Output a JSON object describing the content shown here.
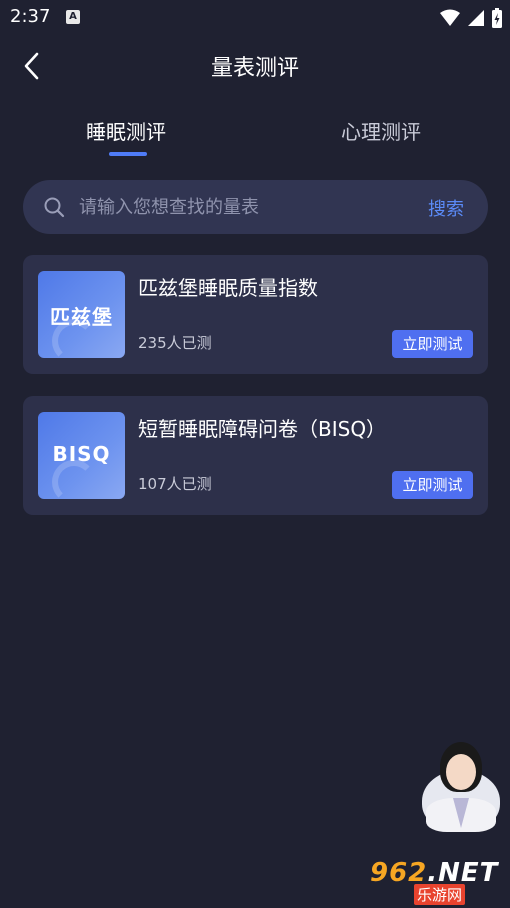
{
  "status_bar": {
    "time": "2:37",
    "notification_icon": "A"
  },
  "header": {
    "title": "量表测评",
    "back_icon": "chevron-left-icon"
  },
  "tabs": [
    {
      "label": "睡眠测评",
      "active": true
    },
    {
      "label": "心理测评",
      "active": false
    }
  ],
  "search": {
    "placeholder": "请输入您想查找的量表",
    "value": "",
    "button_label": "搜索"
  },
  "scales": [
    {
      "thumb_text": "匹兹堡",
      "title": "匹兹堡睡眠质量指数",
      "count": "235人已测",
      "button_label": "立即测试"
    },
    {
      "thumb_text": "BISQ",
      "title": "短暂睡眠障碍问卷（BISQ）",
      "count": "107人已测",
      "button_label": "立即测试"
    }
  ],
  "watermark": {
    "main_prefix": "962",
    "main_suffix": ".NET",
    "sub": "乐游网"
  },
  "colors": {
    "background": "#1f2131",
    "card": "#2d304a",
    "accent": "#4f6ff0",
    "search_text": "#5b8bf8"
  }
}
